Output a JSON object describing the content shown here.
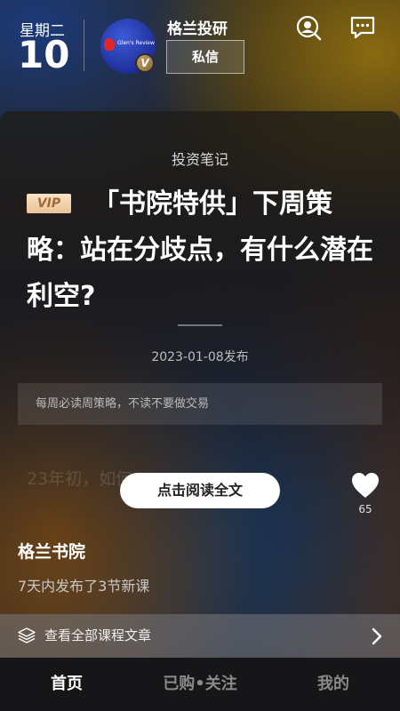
{
  "header": {
    "weekday": "星期二",
    "day": "10",
    "avatar_text": "Glen's Review",
    "verified_badge": "V",
    "channel_name": "格兰投研",
    "dm_label": "私信",
    "icons": [
      "search-icon",
      "message-icon"
    ]
  },
  "article": {
    "category": "投资笔记",
    "vip_label": "VIP",
    "title": "「书院特供」下周策略：站在分歧点，有什么潜在利空?",
    "published": "2023-01-08发布",
    "summary": "每周必读周策略，不读不要做交易",
    "faded_preview": "23年初，如何",
    "read_button": "点击阅读全文",
    "like_count": "65"
  },
  "academy": {
    "name": "格兰书院",
    "subtitle": "7天内发布了3节新课",
    "all_courses_label": "查看全部课程文章"
  },
  "bottom_nav": {
    "home": "首页",
    "bought_follow": "已购•关注",
    "mine": "我的"
  },
  "colors": {
    "accent_gold": "#c8a36a",
    "vip_text": "#a16a34",
    "nav_active": "#ffffff",
    "nav_inactive": "#8a8a8a"
  }
}
